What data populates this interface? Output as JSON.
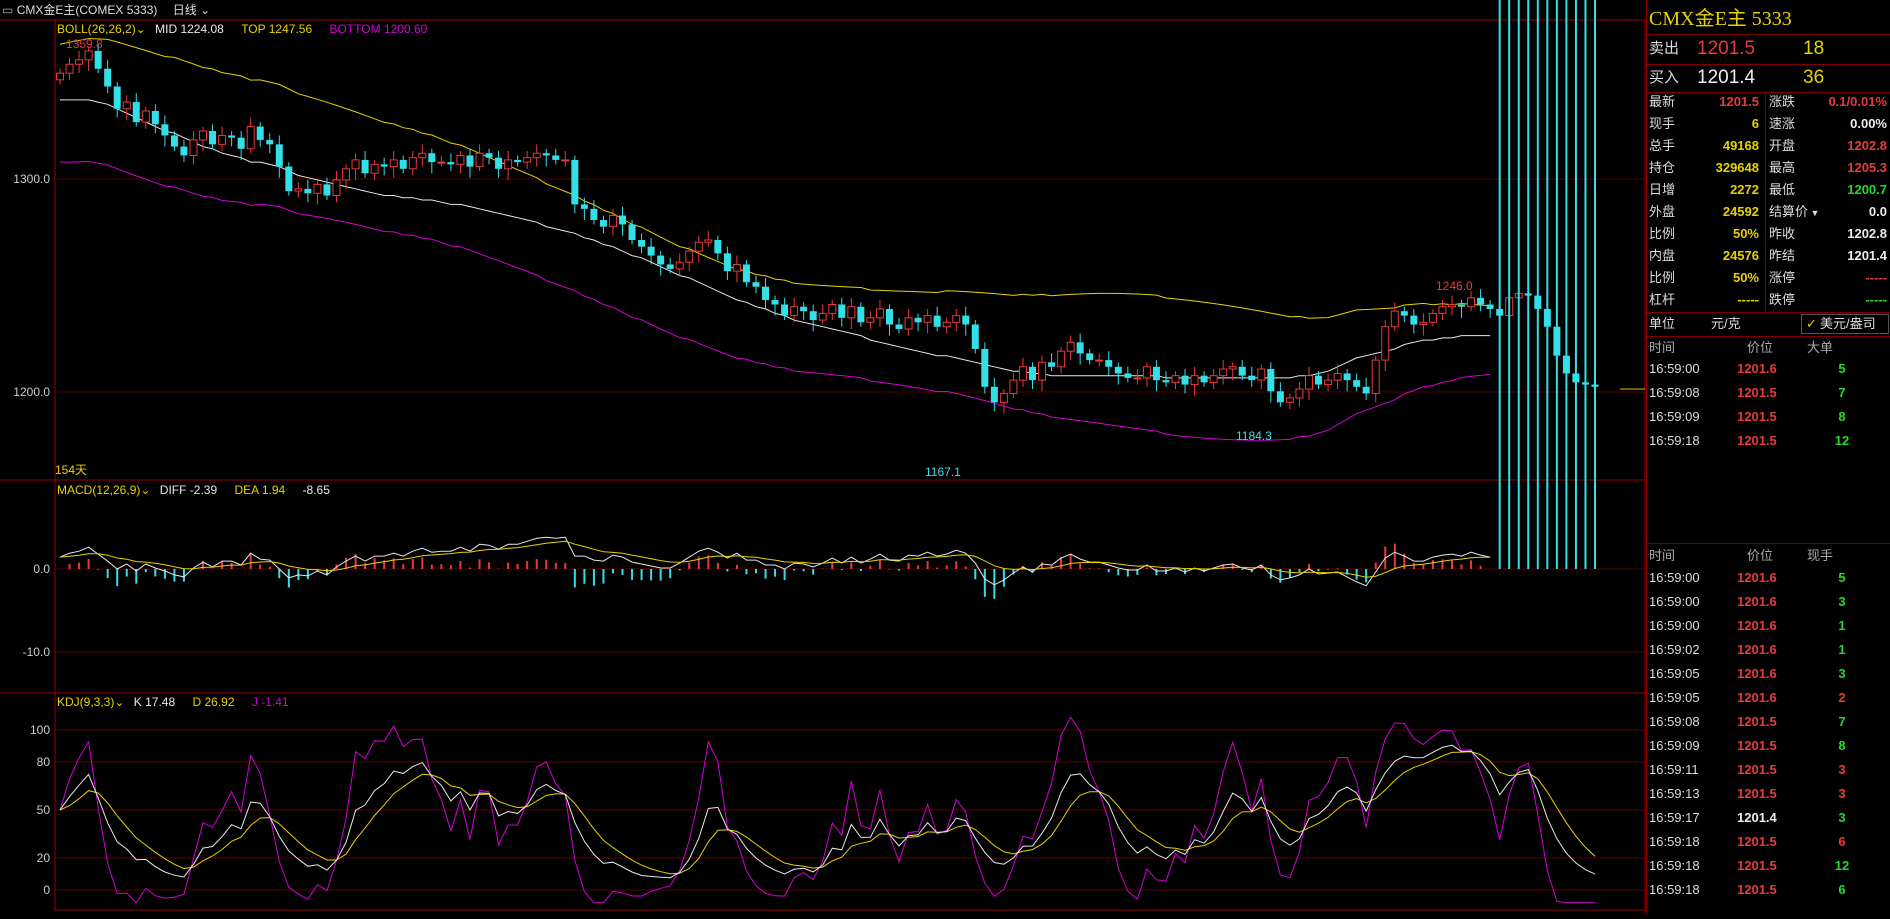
{
  "colors": {
    "up": "#e83a3a",
    "down": "#33e0e8",
    "yellow": "#e6d200",
    "white": "#e8e8e8",
    "magenta": "#d500d5",
    "green": "#27d827",
    "border": "#9a0000"
  },
  "header": {
    "symbol": "CMX金E主(COMEX 5333)",
    "period": "日线"
  },
  "boll": {
    "label": "BOLL(26,26,2)",
    "mid": "MID 1224.08",
    "top": "TOP 1247.56",
    "bottom": "BOTTOM 1200.60"
  },
  "price_axis": [
    "1300.0",
    "1200.0"
  ],
  "annotations": {
    "high": "1359.8",
    "peak2": "1246.0",
    "low1": "1167.1",
    "low2": "1184.3",
    "days": "154天"
  },
  "macd": {
    "label": "MACD(12,26,9)",
    "diff": "DIFF -2.39",
    "dea": "DEA 1.94",
    "macd": "-8.65",
    "axis": [
      "0.0",
      "-10.0"
    ]
  },
  "kdj": {
    "label": "KDJ(9,3,3)",
    "k": "K 17.48",
    "d": "D 26.92",
    "j": "J -1.41",
    "axis": [
      "100",
      "80",
      "50",
      "20",
      "0"
    ]
  },
  "chart_data": {
    "type": "candlestick",
    "y_range": [
      1160,
      1365
    ],
    "closes": [
      1342,
      1346,
      1348,
      1352,
      1344,
      1336,
      1326,
      1329,
      1320,
      1325,
      1319,
      1314,
      1309,
      1305,
      1312,
      1316,
      1310,
      1314,
      1313,
      1308,
      1318,
      1312,
      1310,
      1300,
      1289,
      1290,
      1288,
      1292,
      1287,
      1294,
      1299,
      1303,
      1297,
      1301,
      1300,
      1303,
      1299,
      1304,
      1306,
      1302,
      1302,
      1301,
      1305,
      1300,
      1306,
      1304,
      1299,
      1303,
      1302,
      1304,
      1306,
      1305,
      1303,
      1303,
      1283,
      1281,
      1276,
      1273,
      1278,
      1274,
      1267,
      1264,
      1260,
      1256,
      1254,
      1257,
      1262,
      1266,
      1267,
      1261,
      1253,
      1256,
      1248,
      1246,
      1240,
      1238,
      1233,
      1237,
      1235,
      1231,
      1234,
      1238,
      1232,
      1237,
      1230,
      1232,
      1236,
      1229,
      1227,
      1232,
      1230,
      1233,
      1228,
      1230,
      1233,
      1229,
      1218,
      1201,
      1194,
      1198,
      1204,
      1210,
      1204,
      1212,
      1210,
      1217,
      1221,
      1216,
      1213,
      1213,
      1210,
      1207,
      1205,
      1205,
      1210,
      1204,
      1203,
      1206,
      1202,
      1206,
      1203,
      1206,
      1209,
      1210,
      1206,
      1204,
      1209,
      1199,
      1194,
      1196,
      1200,
      1206,
      1202,
      1204,
      1207,
      1204,
      1201,
      1198,
      1213,
      1228,
      1235,
      1233,
      1229,
      1230,
      1234,
      1237,
      1238,
      1237,
      1241,
      1238,
      1236,
      1233,
      1241,
      1243,
      1242,
      1236,
      1228,
      1215,
      1207,
      1203,
      1202,
      1201
    ],
    "mid": [
      1330,
      1330,
      1330,
      1330,
      1329,
      1328,
      1326,
      1324,
      1322,
      1320,
      1318,
      1316,
      1315,
      1313,
      1311,
      1309,
      1308,
      1306,
      1305,
      1304,
      1302,
      1302,
      1301,
      1300,
      1298,
      1296,
      1295,
      1294,
      1293,
      1292,
      1291,
      1290,
      1289,
      1288,
      1287,
      1287,
      1286,
      1286,
      1285,
      1285,
      1284,
      1283,
      1283,
      1282,
      1281,
      1280,
      1279,
      1278,
      1277,
      1276,
      1275,
      1273,
      1272,
      1271,
      1270,
      1268,
      1267,
      1265,
      1264,
      1262,
      1260,
      1259,
      1257,
      1255,
      1253,
      1251,
      1250,
      1248,
      1246,
      1244,
      1242,
      1240,
      1239,
      1237,
      1236,
      1234,
      1233,
      1231,
      1230,
      1229,
      1228,
      1227,
      1226,
      1225,
      1224,
      1222,
      1221,
      1220,
      1219,
      1218,
      1217,
      1216,
      1215,
      1215,
      1214,
      1213,
      1212,
      1211,
      1210,
      1209,
      1208,
      1208,
      1207,
      1207,
      1206,
      1206,
      1206,
      1206,
      1206,
      1206,
      1206,
      1206,
      1206,
      1206,
      1206,
      1206,
      1205,
      1205,
      1205,
      1205,
      1205,
      1205,
      1205,
      1205,
      1205,
      1205,
      1205,
      1205,
      1205,
      1205,
      1206,
      1206,
      1207,
      1208,
      1210,
      1212,
      1214,
      1215,
      1216,
      1217,
      1218,
      1220,
      1221,
      1222,
      1222,
      1223,
      1223,
      1224,
      1224,
      1224,
      1224
    ]
  },
  "panel": {
    "title": "CMX金E主  5333",
    "sell": {
      "label": "卖出",
      "price": "1201.5",
      "qty": "18"
    },
    "buy": {
      "label": "买入",
      "price": "1201.4",
      "qty": "36"
    },
    "quote_left": [
      {
        "k": "最新",
        "v": "1201.5",
        "c": "up"
      },
      {
        "k": "现手",
        "v": "6",
        "c": "yellow"
      },
      {
        "k": "总手",
        "v": "49168",
        "c": "yellow"
      },
      {
        "k": "持仓",
        "v": "329648",
        "c": "yellow"
      },
      {
        "k": "日增",
        "v": "2272",
        "c": "yellow"
      },
      {
        "k": "外盘",
        "v": "24592",
        "c": "yellow"
      },
      {
        "k": "比例",
        "v": "50%",
        "c": "yellow"
      },
      {
        "k": "内盘",
        "v": "24576",
        "c": "yellow"
      },
      {
        "k": "比例",
        "v": "50%",
        "c": "yellow"
      },
      {
        "k": "杠杆",
        "v": "-----",
        "c": "yellow"
      }
    ],
    "quote_right": [
      {
        "k": "涨跌",
        "v": "0.1/0.01%",
        "c": "up"
      },
      {
        "k": "速涨",
        "v": "0.00%",
        "c": "white"
      },
      {
        "k": "开盘",
        "v": "1202.8",
        "c": "up"
      },
      {
        "k": "最高",
        "v": "1205.3",
        "c": "up"
      },
      {
        "k": "最低",
        "v": "1200.7",
        "c": "green"
      },
      {
        "k": "结算价",
        "v": "0.0",
        "c": "white"
      },
      {
        "k": "昨收",
        "v": "1202.8",
        "c": "white"
      },
      {
        "k": "昨结",
        "v": "1201.4",
        "c": "white"
      },
      {
        "k": "涨停",
        "v": "-----",
        "c": "up"
      },
      {
        "k": "跌停",
        "v": "-----",
        "c": "green"
      }
    ],
    "unit": {
      "label": "单位",
      "value": "元/克",
      "option": "美元/盎司"
    },
    "big_orders": {
      "headers": [
        "时间",
        "价位",
        "大单"
      ],
      "rows": [
        [
          "16:59:00",
          "1201.6",
          "5"
        ],
        [
          "16:59:08",
          "1201.5",
          "7"
        ],
        [
          "16:59:09",
          "1201.5",
          "8"
        ],
        [
          "16:59:18",
          "1201.5",
          "12"
        ]
      ]
    },
    "ticks": {
      "headers": [
        "时间",
        "价位",
        "现手"
      ],
      "rows": [
        [
          "16:59:00",
          "1201.6",
          "5",
          "green"
        ],
        [
          "16:59:00",
          "1201.6",
          "3",
          "green"
        ],
        [
          "16:59:00",
          "1201.6",
          "1",
          "green"
        ],
        [
          "16:59:02",
          "1201.6",
          "1",
          "green"
        ],
        [
          "16:59:05",
          "1201.6",
          "3",
          "green"
        ],
        [
          "16:59:05",
          "1201.6",
          "2",
          "up"
        ],
        [
          "16:59:08",
          "1201.5",
          "7",
          "green"
        ],
        [
          "16:59:09",
          "1201.5",
          "8",
          "green"
        ],
        [
          "16:59:11",
          "1201.5",
          "3",
          "up"
        ],
        [
          "16:59:13",
          "1201.5",
          "3",
          "up"
        ],
        [
          "16:59:17",
          "1201.4",
          "3",
          "green"
        ],
        [
          "16:59:18",
          "1201.5",
          "6",
          "up"
        ],
        [
          "16:59:18",
          "1201.5",
          "12",
          "green"
        ],
        [
          "16:59:18",
          "1201.5",
          "6",
          "green"
        ]
      ]
    }
  }
}
